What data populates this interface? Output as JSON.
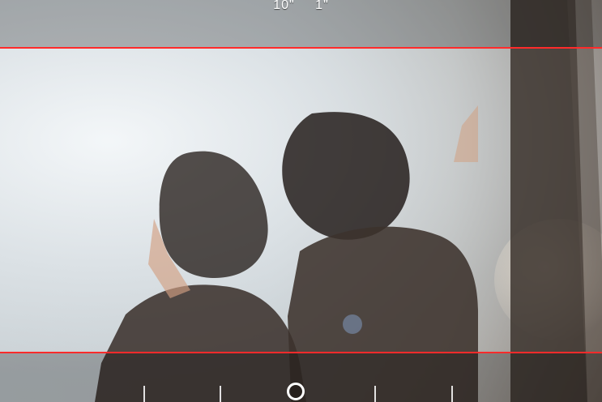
{
  "time_readout": {
    "major": "10\"",
    "minor": "1\""
  },
  "overlay": {
    "frame_color": "#ff2b2b"
  },
  "timeline": {
    "tick_count": 5,
    "playhead_icon": "playhead-circle"
  },
  "icons": {
    "playhead": "playhead-circle-icon"
  }
}
